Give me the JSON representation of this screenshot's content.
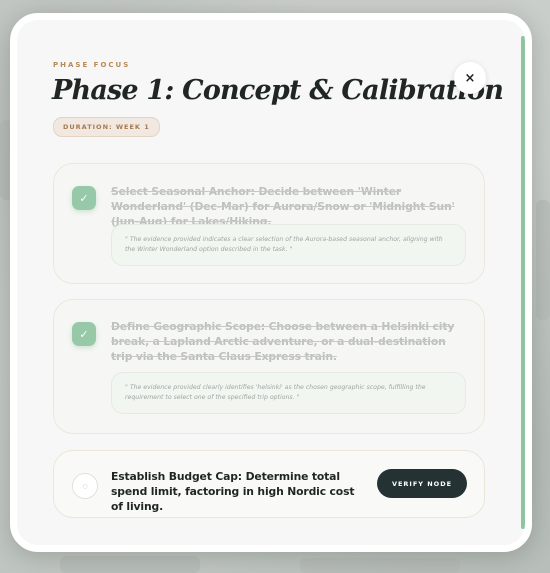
{
  "modal": {
    "eyebrow": "PHASE FOCUS",
    "title": "Phase 1: Concept & Calibration",
    "badge": "DURATION: WEEK 1",
    "close_symbol": "×"
  },
  "tasks": [
    {
      "text": "Select Seasonal Anchor: Decide between 'Winter Wonderland' (Dec-Mar) for Aurora/Snow or 'Midnight Sun' (Jun-Aug) for Lakes/Hiking.",
      "completed": true,
      "check_symbol": "✓",
      "evidence": "\" The evidence provided indicates a clear selection of the Aurora-based seasonal anchor, aligning with the Winter Wonderland option described in the task. \""
    },
    {
      "text": "Define Geographic Scope: Choose between a Helsinki city break, a Lapland Arctic adventure, or a dual-destination trip via the Santa Claus Express train.",
      "completed": true,
      "check_symbol": "✓",
      "evidence": "\" The evidence provided clearly identifies 'helsinki' as the chosen geographic scope, fulfilling the requirement to select one of the specified trip options. \""
    },
    {
      "text": "Establish Budget Cap: Determine total spend limit, factoring in high Nordic cost of living.",
      "completed": false,
      "check_symbol": "○",
      "action_label": "VERIFY NODE"
    }
  ],
  "colors": {
    "accent_green": "#8fc6a2",
    "eyebrow_tan": "#b88a55",
    "button_dark": "#253233"
  },
  "icons": {
    "close": "close-icon",
    "check": "check-icon",
    "pending": "circle-icon"
  }
}
